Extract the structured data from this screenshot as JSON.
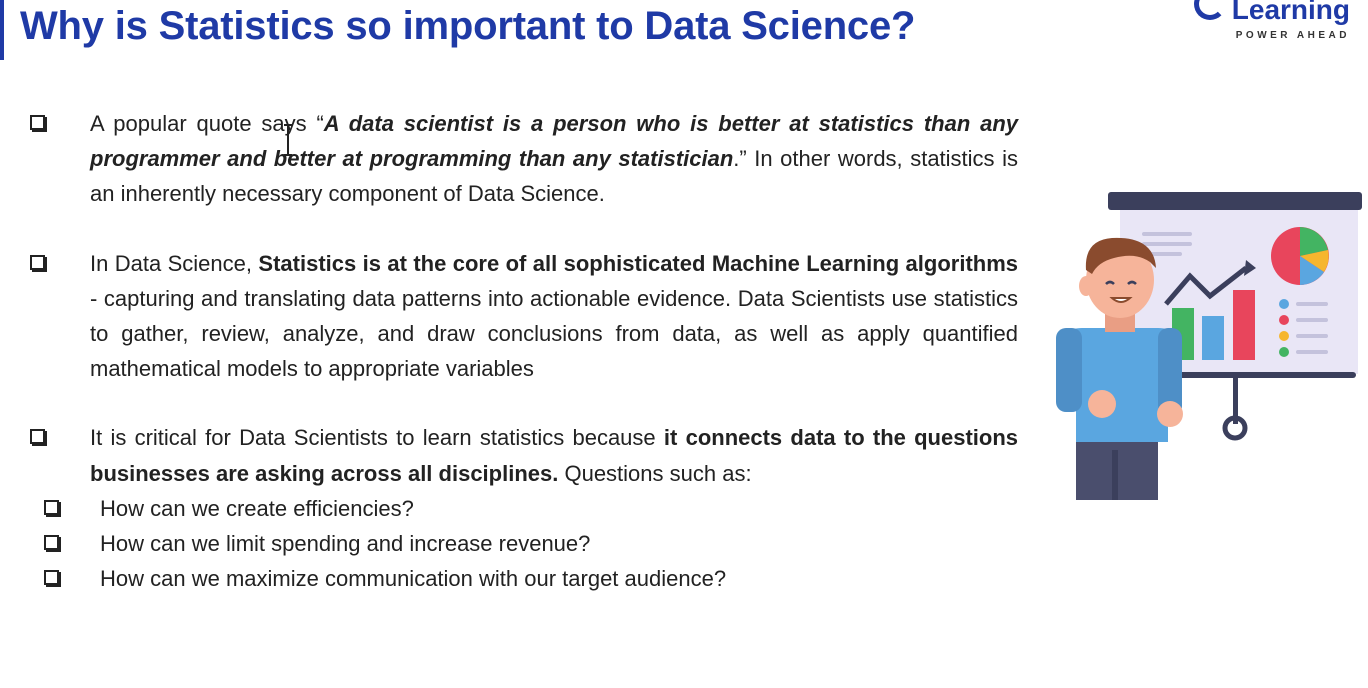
{
  "title": "Why is Statistics so important to Data Science?",
  "logo": {
    "word": "Learning",
    "tagline": "POWER AHEAD"
  },
  "bullets": [
    {
      "pre": "A popular quote says “",
      "emph": "A data scientist is a person who is better at statistics than any programmer and better at programming than any statistician",
      "post": ".” In other words, statistics is an inherently necessary component of Data Science."
    },
    {
      "pre": "In Data Science, ",
      "bold": "Statistics is at the core of all sophisticated Machine Learning algorithms",
      "post": " - capturing and translating data patterns into actionable evidence. Data Scientists use statistics to gather, review, analyze, and draw conclusions from data, as well as apply quantified mathematical models to appropriate variables"
    },
    {
      "pre": "It is critical for Data Scientists to learn statistics because ",
      "bold": "it connects data to the questions businesses are asking across all disciplines.",
      "post": " Questions such as:"
    }
  ],
  "questions": [
    "How can we create efficiencies?",
    "How can we limit spending and increase revenue?",
    "How can we maximize communication with our target audience?"
  ],
  "colors": {
    "title": "#1f3aa6",
    "board": "#e9e6f6",
    "board_top": "#3b3f5c",
    "shirt": "#5aa6e0",
    "hair": "#8a4b2e",
    "skin": "#f6b49a",
    "pants": "#4a4e6d"
  },
  "icons": [
    "checkbox-bullet-icon",
    "text-cursor-icon",
    "presenter-illustration"
  ]
}
